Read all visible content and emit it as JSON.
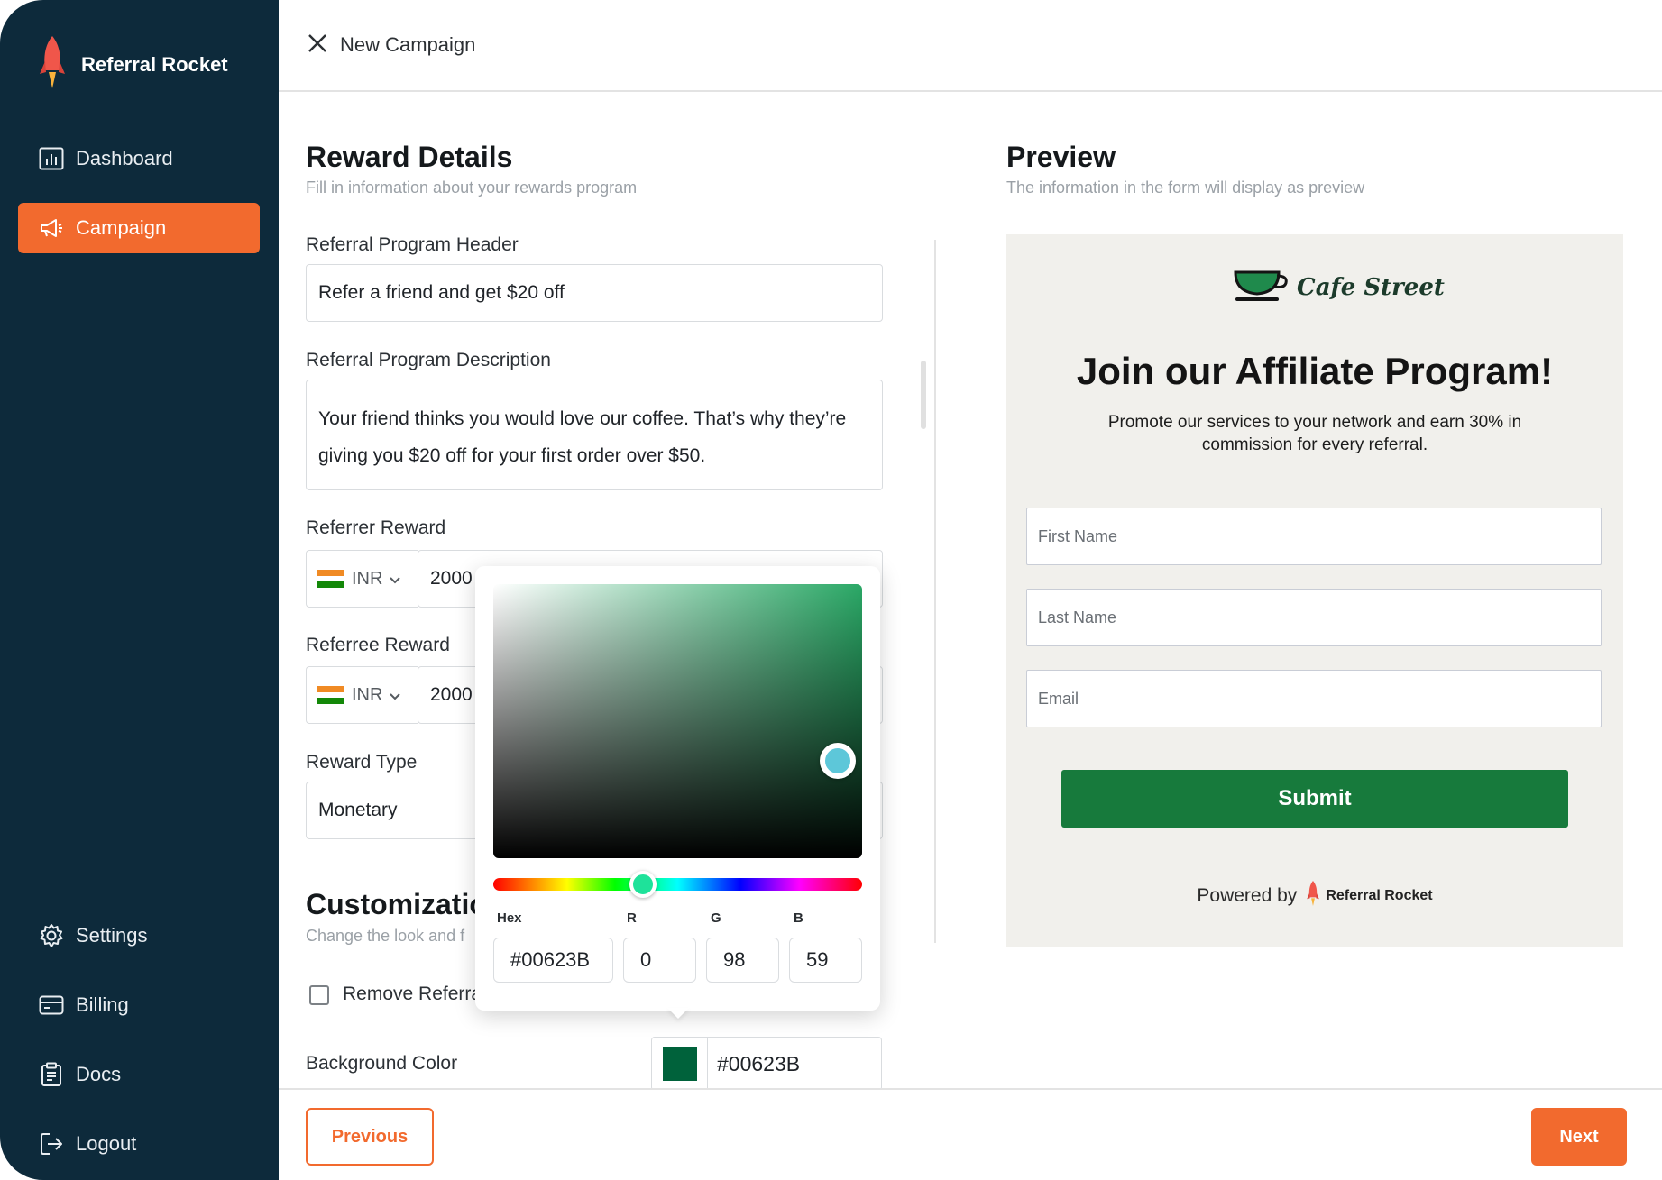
{
  "brand": {
    "name": "Referral Rocket"
  },
  "sidebar": {
    "items": [
      {
        "label": "Dashboard",
        "icon": "chart-icon",
        "active": false
      },
      {
        "label": "Campaign",
        "icon": "megaphone-icon",
        "active": true
      },
      {
        "label": "Settings",
        "icon": "gear-icon",
        "active": false
      },
      {
        "label": "Billing",
        "icon": "credit-card-icon",
        "active": false
      },
      {
        "label": "Docs",
        "icon": "clipboard-icon",
        "active": false
      },
      {
        "label": "Logout",
        "icon": "logout-icon",
        "active": false
      }
    ]
  },
  "topbar": {
    "title": "New Campaign"
  },
  "form": {
    "title": "Reward Details",
    "subtitle": "Fill in information about your rewards program",
    "header_label": "Referral Program Header",
    "header_value": "Refer a friend and get $20 off",
    "description_label": "Referral Program Description",
    "description_value": "Your friend thinks you would love our coffee. That’s why they’re giving you $20 off for your first order over $50.",
    "referrer_label": "Referrer Reward",
    "referrer_currency": "INR",
    "referrer_value": "2000",
    "referee_label": "Referree Reward",
    "referee_currency": "INR",
    "referee_value": "2000",
    "reward_type_label": "Reward Type",
    "reward_type_value": "Monetary"
  },
  "customization": {
    "title": "Customizatio",
    "subtitle": "Change the look and f",
    "remove_label": "Remove Referra",
    "bg_color_label": "Background Color",
    "bg_color_value": "#00623B"
  },
  "color_picker": {
    "hex_label": "Hex",
    "r_label": "R",
    "g_label": "G",
    "b_label": "B",
    "hex_value": "#00623B",
    "r_value": "0",
    "g_value": "98",
    "b_value": "59"
  },
  "preview": {
    "title": "Preview",
    "subtitle": "The information in the form will display as preview",
    "logo_text": "Cafe Street",
    "heading": "Join our Affiliate Program!",
    "description": "Promote our services to your network and earn 30% in commission for every referral.",
    "first_name_placeholder": "First Name",
    "last_name_placeholder": "Last Name",
    "email_placeholder": "Email",
    "submit_label": "Submit",
    "powered_by": "Powered by",
    "powered_brand": "Referral Rocket"
  },
  "footer": {
    "previous_label": "Previous",
    "next_label": "Next"
  },
  "colors": {
    "sidebar_bg": "#0d2a3b",
    "accent": "#f26a2e",
    "preview_submit": "#177a3c",
    "selected_color": "#00623B"
  }
}
